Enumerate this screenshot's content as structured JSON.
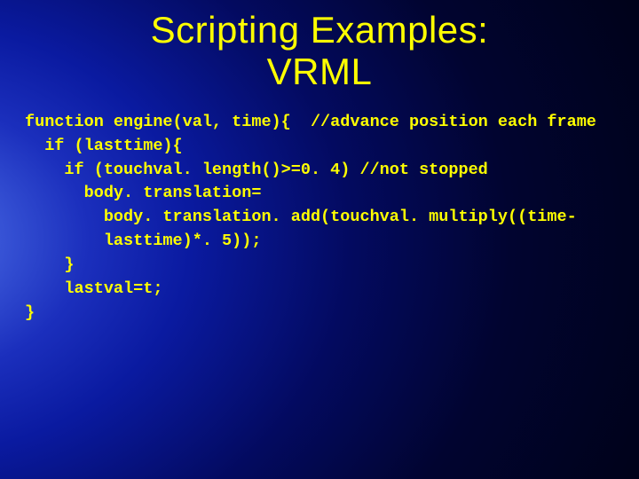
{
  "slide": {
    "title_line1": "Scripting Examples:",
    "title_line2": "VRML",
    "code_line1": "function engine(val, time){  //advance position each frame",
    "code_line2": "  if (lasttime){",
    "code_line3": "    if (touchval. length()>=0. 4) //not stopped",
    "code_line4": "      body. translation=",
    "code_line5": "        body. translation. add(touchval. multiply((time-",
    "code_line6": "        lasttime)*. 5));",
    "code_line7": "    }",
    "code_line8": "    lastval=t;",
    "code_line9": "}"
  }
}
